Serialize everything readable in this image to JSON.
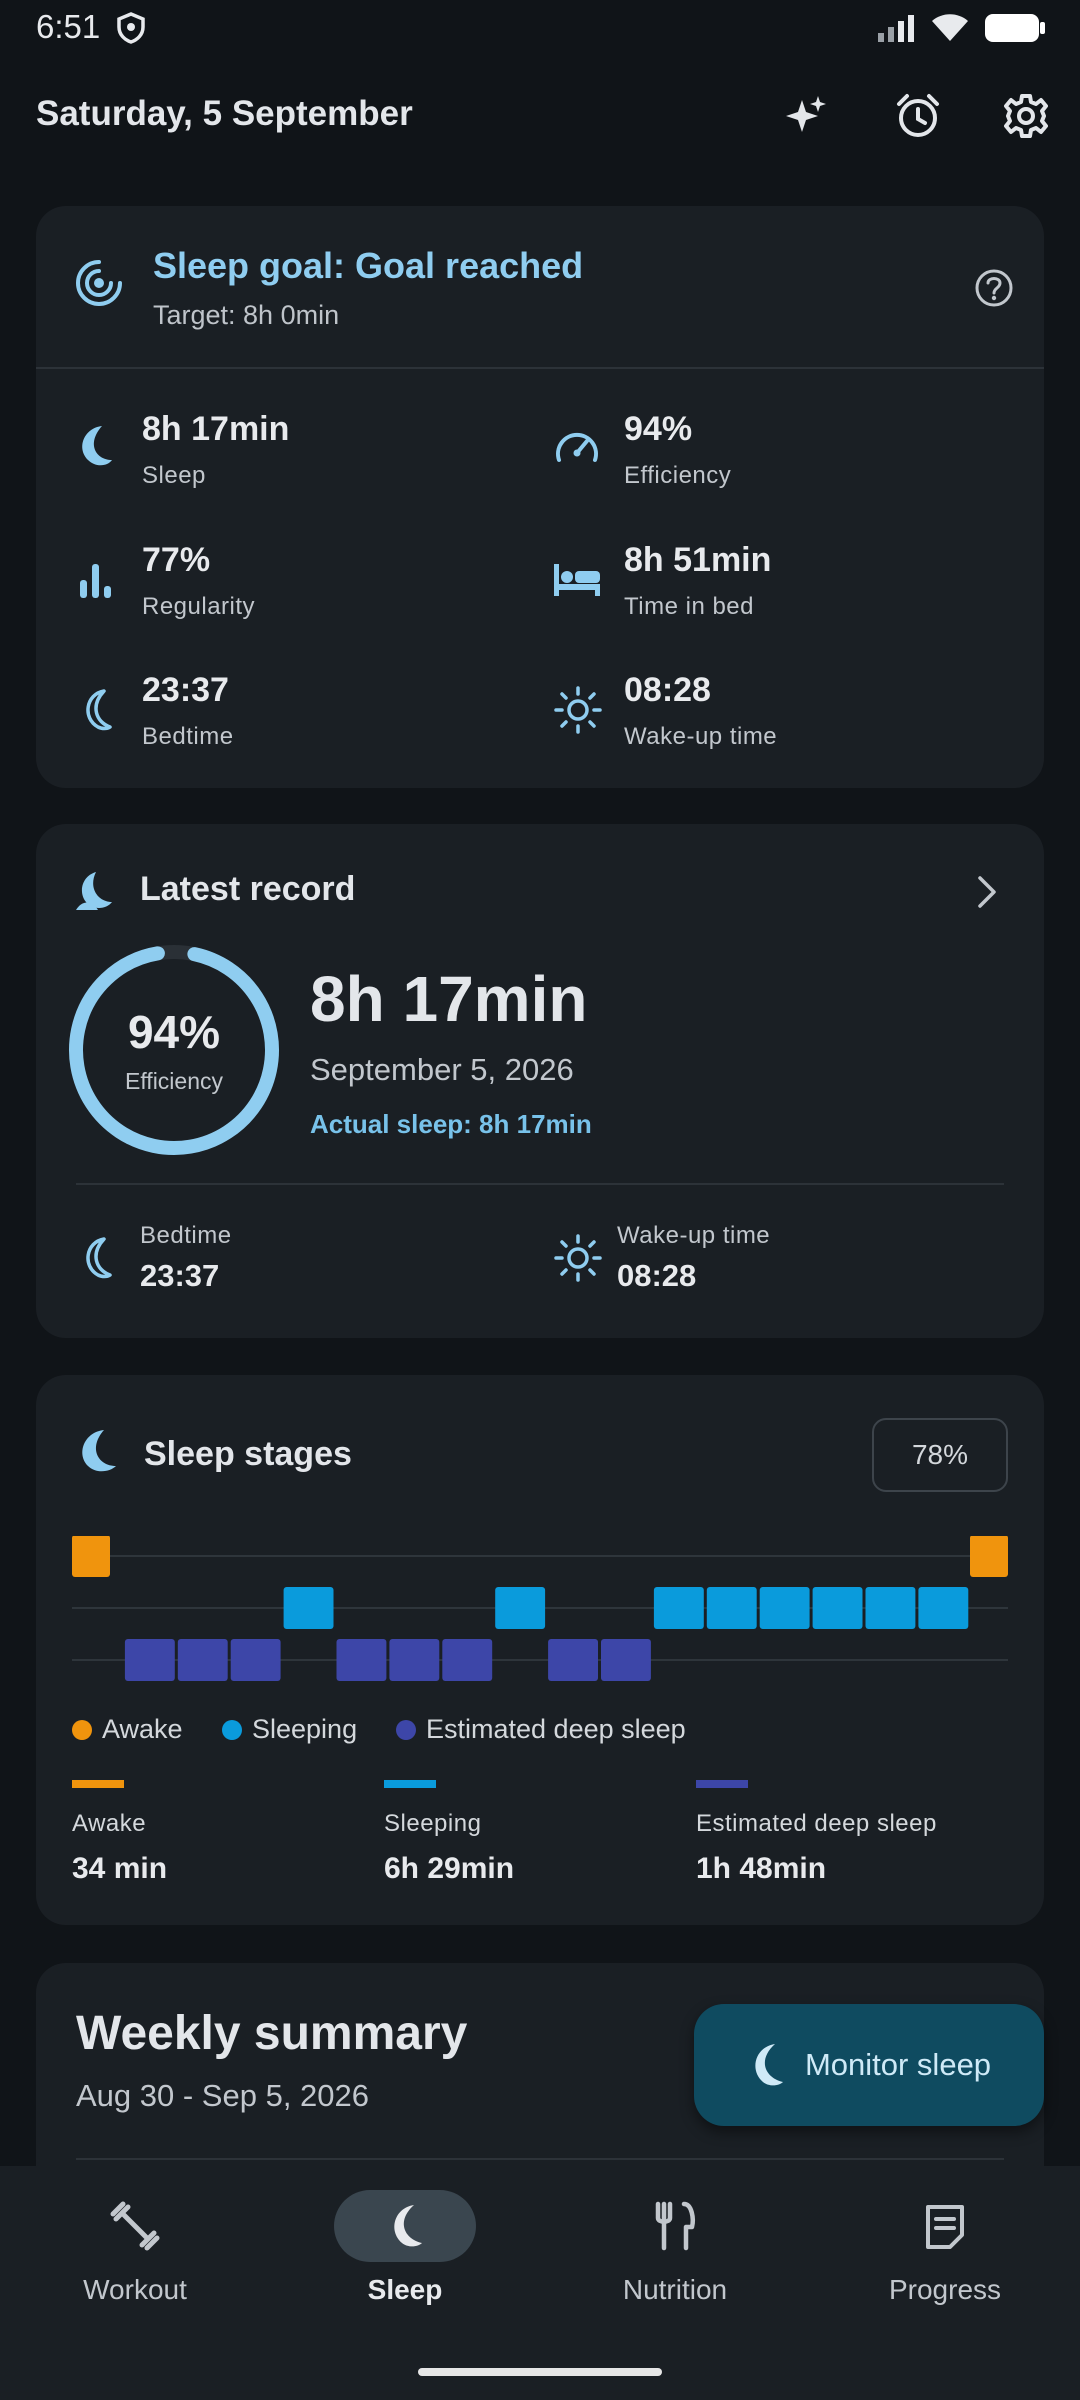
{
  "status_bar": {
    "time": "6:51"
  },
  "header": {
    "date": "Saturday, 5 September"
  },
  "goal_card": {
    "title": "Sleep goal: Goal reached",
    "target": "Target: 8h 0min",
    "stats": [
      {
        "value": "8h 17min",
        "label": "Sleep",
        "icon": "moon-icon"
      },
      {
        "value": "94%",
        "label": "Efficiency",
        "icon": "speedometer-icon"
      },
      {
        "value": "77%",
        "label": "Regularity",
        "icon": "bar-chart-icon"
      },
      {
        "value": "8h 51min",
        "label": "Time in bed",
        "icon": "bed-icon"
      },
      {
        "value": "23:37",
        "label": "Bedtime",
        "icon": "moon-icon"
      },
      {
        "value": "08:28",
        "label": "Wake-up time",
        "icon": "sun-icon"
      }
    ]
  },
  "latest_record": {
    "title": "Latest record",
    "efficiency_pct": "94%",
    "efficiency_value": 0.94,
    "efficiency_label": "Efficiency",
    "duration": "8h 17min",
    "date": "September 5, 2026",
    "actual_sleep": "Actual sleep: 8h 17min",
    "bedtime_label": "Bedtime",
    "bedtime": "23:37",
    "wake_label": "Wake-up time",
    "wake": "08:28"
  },
  "sleep_stages": {
    "title": "Sleep stages",
    "badge": "78%",
    "colors": {
      "awake": "#f0940d",
      "sleeping": "#0a9bdc",
      "deep": "#3d46a8"
    },
    "timeline": [
      "awake",
      "deep",
      "deep",
      "deep",
      "sleeping",
      "deep",
      "deep",
      "deep",
      "sleeping",
      "deep",
      "deep",
      "sleeping",
      "sleeping",
      "sleeping",
      "sleeping",
      "sleeping",
      "sleeping",
      "awake"
    ],
    "legend": {
      "awake": "Awake",
      "sleeping": "Sleeping",
      "deep": "Estimated deep sleep"
    },
    "summary": [
      {
        "label": "Awake",
        "value": "34 min"
      },
      {
        "label": "Sleeping",
        "value": "6h 29min"
      },
      {
        "label": "Estimated deep sleep",
        "value": "1h 48min"
      }
    ]
  },
  "weekly": {
    "title": "Weekly summary",
    "range": "Aug 30 - Sep 5, 2026"
  },
  "fab": {
    "label": "Monitor sleep"
  },
  "nav": {
    "items": [
      {
        "label": "Workout",
        "icon": "dumbbell-icon"
      },
      {
        "label": "Sleep",
        "icon": "moon-icon",
        "active": true
      },
      {
        "label": "Nutrition",
        "icon": "fork-knife-icon"
      },
      {
        "label": "Progress",
        "icon": "document-icon"
      }
    ]
  }
}
